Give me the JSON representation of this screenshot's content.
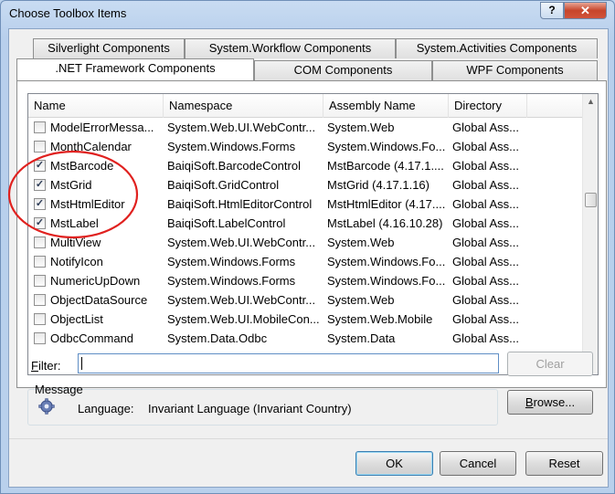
{
  "window": {
    "title": "Choose Toolbox Items",
    "help_label": "?",
    "close_label": "✕"
  },
  "tabs_top": [
    {
      "label": "Silverlight Components"
    },
    {
      "label": "System.Workflow Components"
    },
    {
      "label": "System.Activities Components"
    }
  ],
  "tabs_bottom": [
    {
      "label": ".NET Framework Components",
      "active": true
    },
    {
      "label": "COM Components"
    },
    {
      "label": "WPF Components"
    }
  ],
  "table": {
    "columns": [
      "Name",
      "Namespace",
      "Assembly Name",
      "Directory"
    ],
    "rows": [
      {
        "checked": false,
        "name": "ModelErrorMessa...",
        "namespace": "System.Web.UI.WebContr...",
        "assembly": "System.Web",
        "directory": "Global Ass..."
      },
      {
        "checked": false,
        "name": "MonthCalendar",
        "namespace": "System.Windows.Forms",
        "assembly": "System.Windows.Fo...",
        "directory": "Global Ass..."
      },
      {
        "checked": true,
        "name": "MstBarcode",
        "namespace": "BaiqiSoft.BarcodeControl",
        "assembly": "MstBarcode (4.17.1....",
        "directory": "Global Ass..."
      },
      {
        "checked": true,
        "name": "MstGrid",
        "namespace": "BaiqiSoft.GridControl",
        "assembly": "MstGrid (4.17.1.16)",
        "directory": "Global Ass..."
      },
      {
        "checked": true,
        "name": "MstHtmlEditor",
        "namespace": "BaiqiSoft.HtmlEditorControl",
        "assembly": "MstHtmlEditor (4.17....",
        "directory": "Global Ass..."
      },
      {
        "checked": true,
        "name": "MstLabel",
        "namespace": "BaiqiSoft.LabelControl",
        "assembly": "MstLabel (4.16.10.28)",
        "directory": "Global Ass..."
      },
      {
        "checked": false,
        "name": "MultiView",
        "namespace": "System.Web.UI.WebContr...",
        "assembly": "System.Web",
        "directory": "Global Ass..."
      },
      {
        "checked": false,
        "name": "NotifyIcon",
        "namespace": "System.Windows.Forms",
        "assembly": "System.Windows.Fo...",
        "directory": "Global Ass..."
      },
      {
        "checked": false,
        "name": "NumericUpDown",
        "namespace": "System.Windows.Forms",
        "assembly": "System.Windows.Fo...",
        "directory": "Global Ass..."
      },
      {
        "checked": false,
        "name": "ObjectDataSource",
        "namespace": "System.Web.UI.WebContr...",
        "assembly": "System.Web",
        "directory": "Global Ass..."
      },
      {
        "checked": false,
        "name": "ObjectList",
        "namespace": "System.Web.UI.MobileCon...",
        "assembly": "System.Web.Mobile",
        "directory": "Global Ass..."
      },
      {
        "checked": false,
        "name": "OdbcCommand",
        "namespace": "System.Data.Odbc",
        "assembly": "System.Data",
        "directory": "Global Ass..."
      }
    ]
  },
  "filter": {
    "label": "Filter:",
    "value": "",
    "clear_label": "Clear"
  },
  "message": {
    "label": "Message",
    "language_label": "Language:",
    "language_value": "Invariant Language (Invariant Country)",
    "browse_label": "Browse..."
  },
  "buttons": {
    "ok": "OK",
    "cancel": "Cancel",
    "reset": "Reset"
  },
  "colors": {
    "annotation_circle": "#e0211f",
    "checkmark": "#2b3a55",
    "title_bar": "#b9d0ec"
  },
  "icons": {
    "message": "gear-icon",
    "scroll_up": "scroll-up-arrow-icon",
    "scroll_down": "scroll-down-arrow-icon"
  }
}
